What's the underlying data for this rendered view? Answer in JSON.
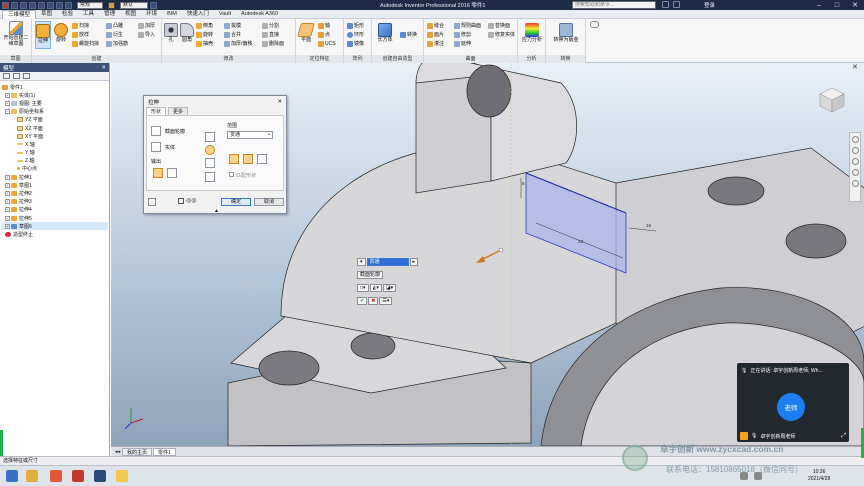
{
  "titlebar": {
    "style_combo": "常规",
    "material_combo": "默认",
    "app_title": "Autodesk Inventor Professional 2016  零件1",
    "search_placeholder": "搜索帮助和命令...",
    "login": "登录"
  },
  "menu": {
    "tabs": [
      "三维模型",
      "草图",
      "检验",
      "工具",
      "管理",
      "视图",
      "环境",
      "BIM",
      "快速入门",
      "Vault",
      "Autodesk A360"
    ]
  },
  "ribbon": {
    "panels": {
      "sketch": "草图",
      "create": "创建",
      "modify": "修改",
      "locate": "定位特征",
      "pattern": "阵列",
      "freeform": "创建自由造型",
      "surface": "曲面",
      "analysis": "分析",
      "convert": "转换"
    },
    "start_sketch": "开始创建二维草图",
    "extrude": "拉伸",
    "revolve": "旋转",
    "create_items": [
      "扫掠",
      "放样",
      "螺旋扫掠",
      "凸雕",
      "衍生",
      "加厚",
      "加强筋",
      "导入"
    ],
    "modify_items": [
      "孔",
      "圆角",
      "倒角",
      "抽壳",
      "拔模",
      "螺纹",
      "分割",
      "合并",
      "直接",
      "删除面",
      "旋转",
      "加厚/偏移",
      "UCS"
    ],
    "locate_items": [
      "平面",
      "轴",
      "点",
      "UCS"
    ],
    "pattern_items": [
      "矩形",
      "环形",
      "镜像"
    ],
    "freeform_items": [
      "长方体",
      "转换"
    ],
    "surface_items": [
      "缝合",
      "面片",
      "灌注",
      "修剪",
      "延伸",
      "规则曲面",
      "替换面",
      "修复实体"
    ],
    "analysis_label": "应力分析",
    "convert_label": "转换为钣金"
  },
  "browser": {
    "title": "模型",
    "items": [
      {
        "label": "零件1",
        "level": 0
      },
      {
        "label": "实体(1)",
        "level": 1
      },
      {
        "label": "视图: 主要",
        "level": 1
      },
      {
        "label": "原始坐标系",
        "level": 1
      },
      {
        "label": "YZ 平面",
        "level": 2
      },
      {
        "label": "XZ 平面",
        "level": 2
      },
      {
        "label": "XY 平面",
        "level": 2
      },
      {
        "label": "X 轴",
        "level": 2
      },
      {
        "label": "Y 轴",
        "level": 2
      },
      {
        "label": "Z 轴",
        "level": 2
      },
      {
        "label": "中心点",
        "level": 2
      },
      {
        "label": "拉伸1",
        "level": 1
      },
      {
        "label": "草图1",
        "level": 1
      },
      {
        "label": "拉伸2",
        "level": 1
      },
      {
        "label": "拉伸3",
        "level": 1
      },
      {
        "label": "拉伸4",
        "level": 1
      },
      {
        "label": "拉伸5",
        "level": 1
      },
      {
        "label": "草图6",
        "level": 1
      },
      {
        "label": "造型终止",
        "level": 1
      }
    ]
  },
  "dialog": {
    "title": "拉伸",
    "tabs": [
      "形状",
      "更多"
    ],
    "profile_label": "截面轮廓",
    "solid_label": "实体",
    "output_label": "输出",
    "extents_label": "范围",
    "extents_value": "贯通",
    "match_shape": "匹配形状",
    "ok": "确定",
    "cancel": "取消"
  },
  "minitoolbar": {
    "value": "贯通",
    "profile": "截面轮廓"
  },
  "dimensions": {
    "d1": "6",
    "d2": "23",
    "d3": "16"
  },
  "doc_tabs": [
    "我的主页",
    "零件1"
  ],
  "status_text": "选择特征或尺寸",
  "call": {
    "speaking": "正在讲话: 卓宇创新周老师; Wh...",
    "avatar": "老师",
    "presenter": "卓宇创新周老师"
  },
  "watermark": {
    "line1": "卓宇创新  www.zycxcad.com.cn",
    "line2": "联系电话：15810865018（微信同号）"
  },
  "clock": {
    "time": "10:36",
    "date": "2021/4/28"
  }
}
